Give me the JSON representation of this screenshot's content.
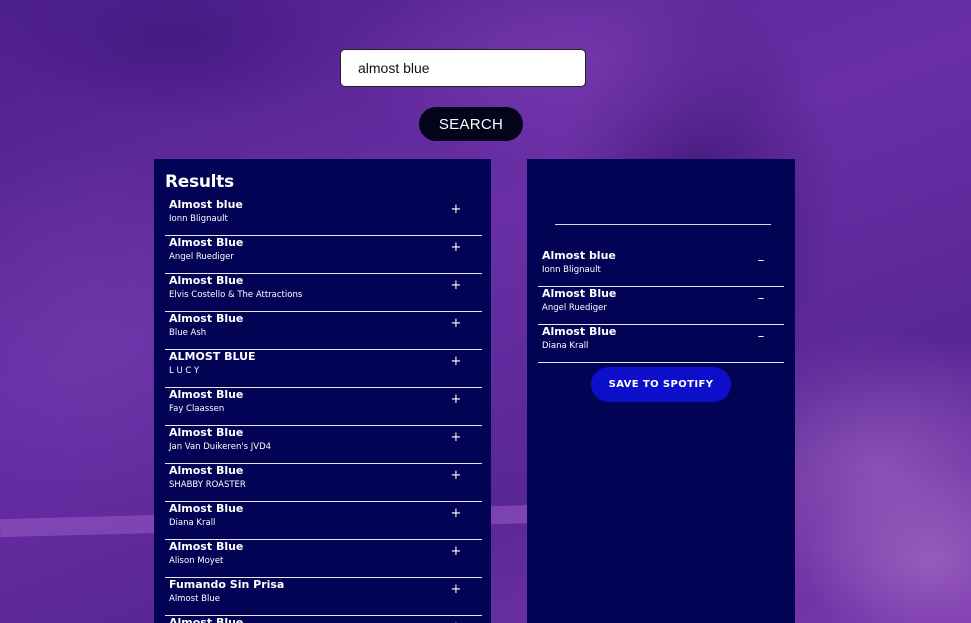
{
  "search": {
    "value": "almost blue",
    "button_label": "SEARCH"
  },
  "results": {
    "title": "Results",
    "tracks": [
      {
        "name": "Almost blue",
        "artist": "Ionn Blignault",
        "action": "+"
      },
      {
        "name": "Almost Blue",
        "artist": "Angel Ruediger",
        "action": "+"
      },
      {
        "name": "Almost Blue",
        "artist": "Elvis Costello & The Attractions",
        "action": "+"
      },
      {
        "name": "Almost Blue",
        "artist": "Blue Ash",
        "action": "+"
      },
      {
        "name": "ALMOST BLUE",
        "artist": "L U C Y",
        "action": "+"
      },
      {
        "name": "Almost Blue",
        "artist": "Fay Claassen",
        "action": "+"
      },
      {
        "name": "Almost Blue",
        "artist": "Jan Van Duikeren's JVD4",
        "action": "+"
      },
      {
        "name": "Almost Blue",
        "artist": "SHABBY ROASTER",
        "action": "+"
      },
      {
        "name": "Almost Blue",
        "artist": "Diana Krall",
        "action": "+"
      },
      {
        "name": "Almost Blue",
        "artist": "Alison Moyet",
        "action": "+"
      },
      {
        "name": "Fumando Sin Prisa",
        "artist": "Almost Blue",
        "action": "+"
      },
      {
        "name": "Almost Blue",
        "artist": "",
        "action": "+"
      }
    ]
  },
  "playlist": {
    "name_value": "",
    "tracks": [
      {
        "name": "Almost blue",
        "artist": "Ionn Blignault",
        "action": "–"
      },
      {
        "name": "Almost Blue",
        "artist": "Angel Ruediger",
        "action": "–"
      },
      {
        "name": "Almost Blue",
        "artist": "Diana Krall",
        "action": "–"
      }
    ],
    "save_label": "SAVE TO SPOTIFY"
  },
  "colors": {
    "background": "#5b2597",
    "panel": "#020355",
    "search_button": "#03031a",
    "save_button": "#0d0fcb"
  }
}
